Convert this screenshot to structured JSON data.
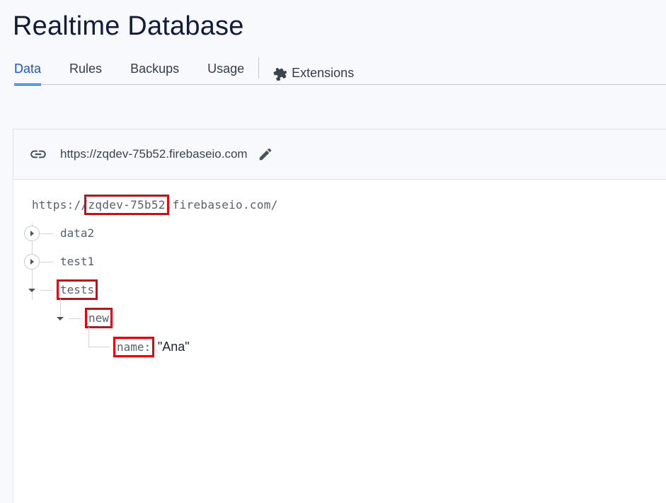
{
  "header": {
    "title": "Realtime Database"
  },
  "tabs": [
    {
      "label": "Data",
      "active": true
    },
    {
      "label": "Rules",
      "active": false
    },
    {
      "label": "Backups",
      "active": false
    },
    {
      "label": "Usage",
      "active": false
    },
    {
      "label": "Extensions",
      "active": false,
      "icon": "puzzle-icon"
    }
  ],
  "card": {
    "url": "https://zqdev-75b52.firebaseio.com",
    "link_icon": "link-icon",
    "edit_icon": "pencil-icon"
  },
  "tree": {
    "root_prefix": "https://",
    "root_project": "zqdev-75b52",
    "root_suffix": ".firebaseio.com/",
    "nodes": {
      "data2": "data2",
      "test1": "test1",
      "tests": "tests",
      "new": "new",
      "name_key": "name:",
      "name_value": "\"Ana\""
    }
  },
  "colors": {
    "accent": "#1a56c4",
    "highlight": "#e8000b"
  }
}
